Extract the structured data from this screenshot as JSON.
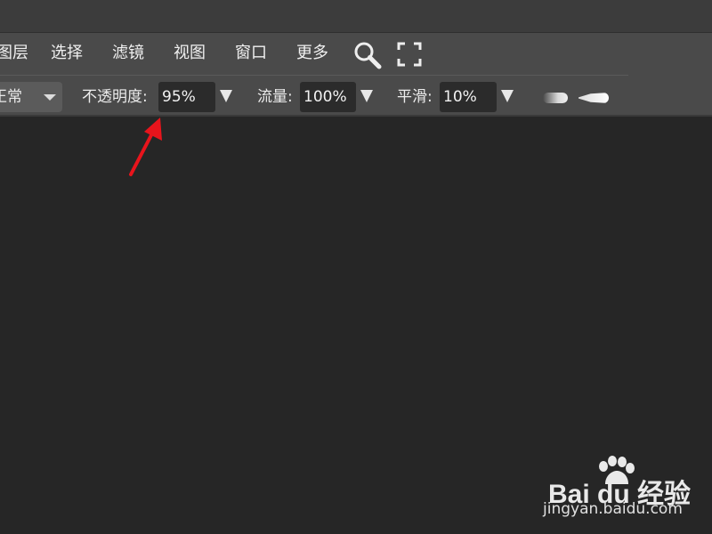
{
  "menu": {
    "items": [
      {
        "label": "图层"
      },
      {
        "label": "选择"
      },
      {
        "label": "滤镜"
      },
      {
        "label": "视图"
      },
      {
        "label": "窗口"
      },
      {
        "label": "更多"
      }
    ],
    "icons": [
      "search-icon",
      "fullscreen-icon"
    ]
  },
  "options": {
    "mode_value": "正常",
    "opacity_label": "不透明度:",
    "opacity_value": "95%",
    "flow_label": "流量:",
    "flow_value": "100%",
    "smoothing_label": "平滑:",
    "smoothing_value": "10%"
  },
  "annotation": {
    "arrow_color": "#e8141c"
  },
  "watermark": {
    "brand": "Bai du 经验",
    "url": "jingyan.baidu.com"
  },
  "colors": {
    "menubar_bg": "#4a4a4a",
    "workspace_bg": "#262626",
    "field_bg": "#2b2b2b"
  }
}
